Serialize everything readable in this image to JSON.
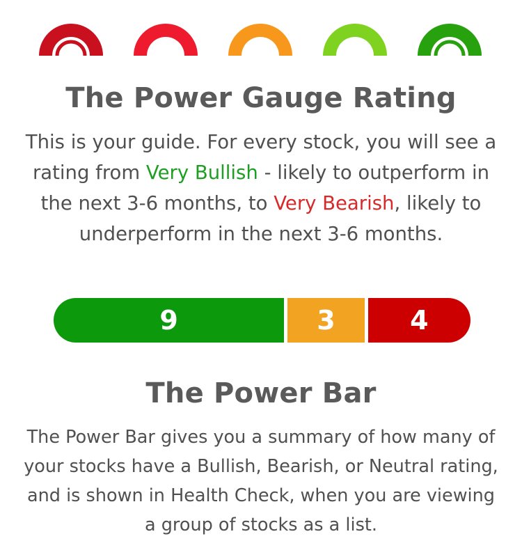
{
  "gauges": [
    {
      "name": "very-bearish-gauge-icon",
      "color": "#c8101e",
      "inner": true
    },
    {
      "name": "bearish-gauge-icon",
      "color": "#ee1b2e",
      "inner": false
    },
    {
      "name": "neutral-gauge-icon",
      "color": "#f7981d",
      "inner": false
    },
    {
      "name": "bullish-gauge-icon",
      "color": "#7fd320",
      "inner": false
    },
    {
      "name": "very-bullish-gauge-icon",
      "color": "#27a10e",
      "inner": true
    }
  ],
  "gauge_section": {
    "title": "The Power Gauge Rating",
    "desc_part1": "This is your guide. For every stock, you will see a rating from ",
    "very_bullish": "Very Bullish",
    "desc_part2": " - likely to outperform in the next 3-6 months, to ",
    "very_bearish": "Very Bearish",
    "desc_part3": ", likely to underperform in the next 3-6 months."
  },
  "power_bar": {
    "bullish_count": "9",
    "neutral_count": "3",
    "bearish_count": "4",
    "colors": {
      "bullish": "#0c990c",
      "neutral": "#f2a321",
      "bearish": "#cc0000"
    }
  },
  "bar_section": {
    "title": "The Power Bar",
    "description": "The Power Bar gives you a summary of how many of your stocks have a Bullish, Bearish, or Neutral rating, and is shown in Health Check, when you are viewing a group of stocks as a list."
  }
}
